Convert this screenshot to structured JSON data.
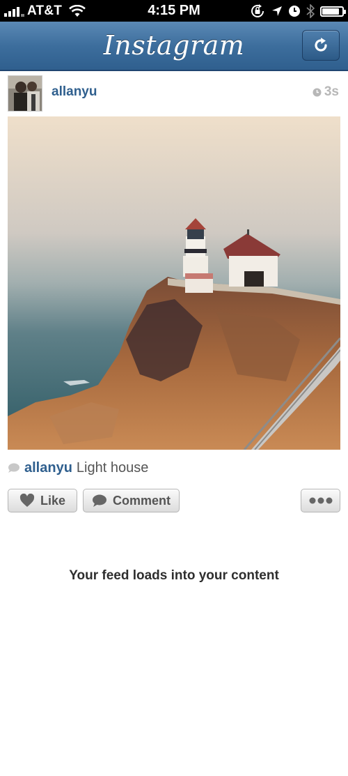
{
  "status_bar": {
    "carrier": "AT&T",
    "time": "4:15 PM",
    "battery_level": 0.85
  },
  "nav": {
    "title": "Instagram",
    "refresh_icon": "refresh-icon"
  },
  "post": {
    "username": "allanyu",
    "time_ago": "3s",
    "caption_user": "allanyu",
    "caption_text": "Light house"
  },
  "actions": {
    "like_label": "Like",
    "comment_label": "Comment",
    "more_icon": "more-icon"
  },
  "feed_message": "Your feed loads into your content",
  "colors": {
    "nav_blue": "#3d6e9d",
    "username_blue": "#2f5f8e",
    "button_text": "#555555"
  }
}
